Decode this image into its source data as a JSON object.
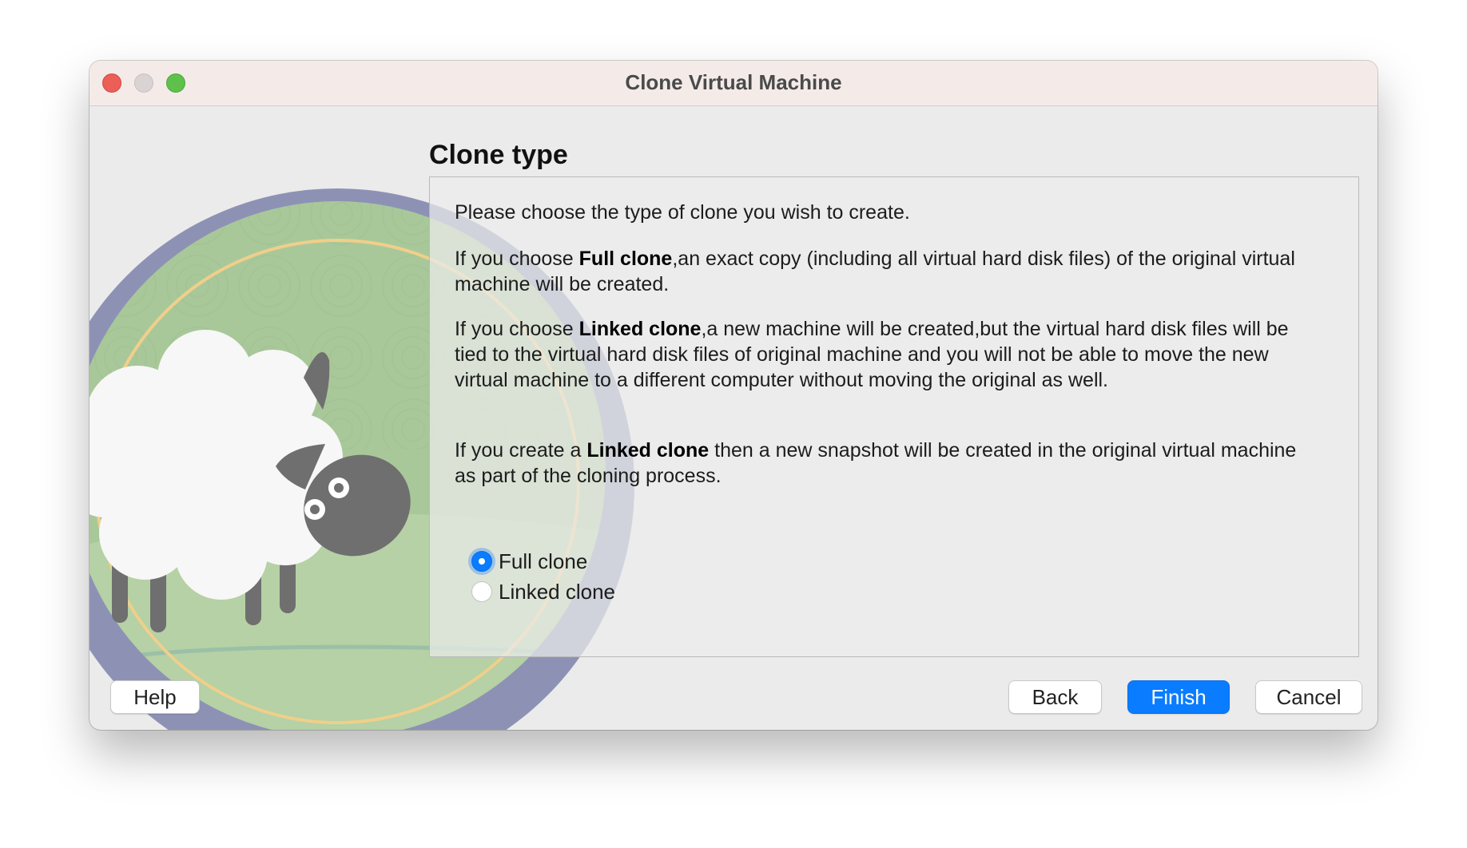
{
  "window": {
    "title": "Clone Virtual Machine"
  },
  "page": {
    "heading": "Clone type",
    "intro": "Please choose the type of clone you wish to create.",
    "full_clone_para": {
      "prefix": "If you choose ",
      "bold": "Full clone",
      "suffix": ",an exact copy (including all virtual hard disk files) of the original virtual machine will be created."
    },
    "linked_clone_para": {
      "prefix": "If you choose ",
      "bold": "Linked clone",
      "suffix": ",a new machine will be created,but the virtual hard disk files will be tied to the virtual hard disk files of original machine and you will not be able to move the new virtual machine to a different computer without moving the original as well."
    },
    "snapshot_para": {
      "prefix": "If you create a ",
      "bold": "Linked clone",
      "suffix": " then a new snapshot will be created in the original virtual machine as part of the cloning process."
    }
  },
  "options": [
    {
      "label": "Full clone",
      "selected": true
    },
    {
      "label": "Linked clone",
      "selected": false
    }
  ],
  "buttons": {
    "help": "Help",
    "back": "Back",
    "finish": "Finish",
    "cancel": "Cancel"
  },
  "colors": {
    "accent": "#0a7cff",
    "titlebar": "#f4ebe9",
    "art_ring": "#8d92b5",
    "art_field": "#a9c89a",
    "sheep_head": "#6f6f6f"
  },
  "icons": {
    "close": "close-icon",
    "minimize": "minimize-icon",
    "zoom": "zoom-icon",
    "illustration": "sheep-icon"
  }
}
